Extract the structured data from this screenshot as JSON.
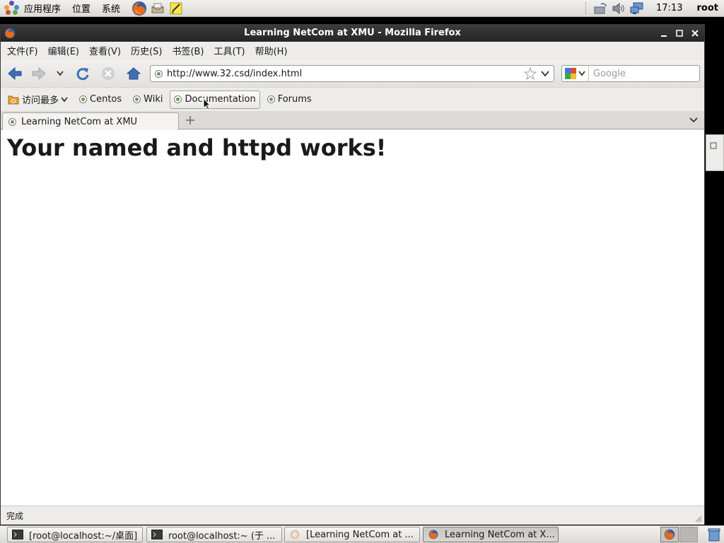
{
  "top_panel": {
    "menus": [
      "应用程序",
      "位置",
      "系统"
    ],
    "launchers": [
      "firefox-icon",
      "mail-icon",
      "notes-icon"
    ],
    "tray_icons": [
      "network-icon",
      "volume-icon",
      "display-icon"
    ],
    "clock": "17:13",
    "user": "root"
  },
  "window": {
    "title": "Learning NetCom at XMU - Mozilla Firefox",
    "menubar": [
      "文件(F)",
      "编辑(E)",
      "查看(V)",
      "历史(S)",
      "书签(B)",
      "工具(T)",
      "帮助(H)"
    ],
    "url": "http://www.32.csd/index.html",
    "search_placeholder": "Google",
    "bookmarks": {
      "most_visited": "访问最多",
      "items": [
        "Centos",
        "Wiki",
        "Documentation",
        "Forums"
      ]
    },
    "tab_title": "Learning NetCom at XMU",
    "page_heading": "Your named and httpd works!",
    "status": "完成"
  },
  "taskbar": {
    "tasks": [
      "[root@localhost:~/桌面]",
      "root@localhost:~ (于 ...",
      "[Learning NetCom at ...",
      "Learning NetCom at X..."
    ]
  },
  "colors": {
    "title_bar": "#2e2e2e",
    "panel": "#e6e4e0",
    "accent_blue": "#3d6fb8"
  }
}
